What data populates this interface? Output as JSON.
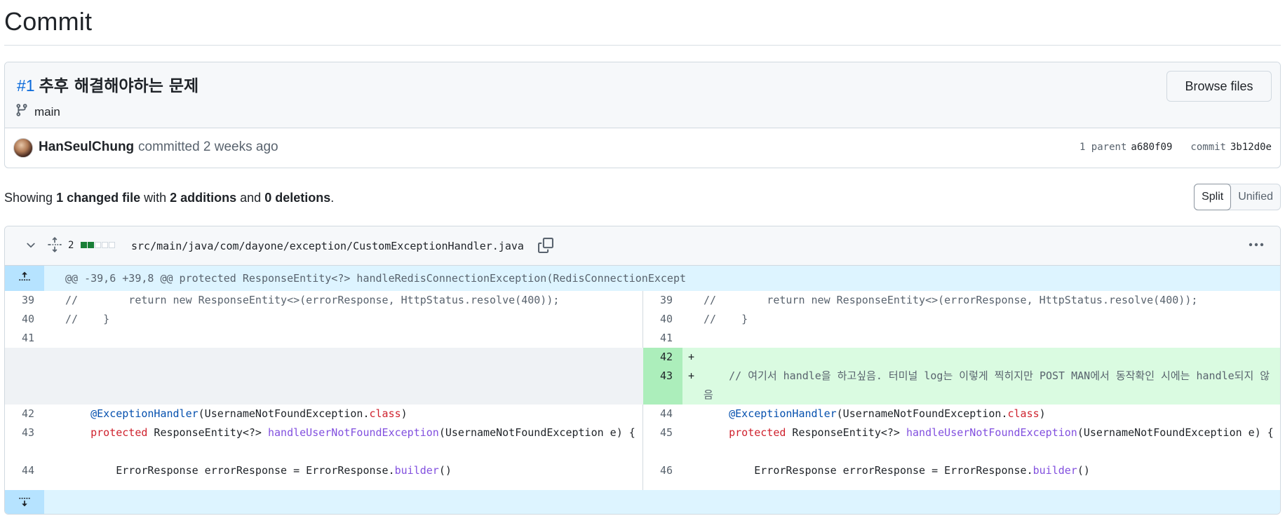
{
  "page": {
    "title": "Commit"
  },
  "commit": {
    "number": "#1",
    "message": "추후 해결해야하는 문제",
    "branch": "main",
    "browse_files_label": "Browse files",
    "author": "HanSeulChung",
    "committed_text": "committed 2 weeks ago",
    "parent_label": "1 parent",
    "parent_sha": "a680f09",
    "commit_label": "commit",
    "commit_sha": "3b12d0e"
  },
  "summary": {
    "prefix": "Showing ",
    "changed": "1 changed file",
    "with": " with ",
    "additions": "2 additions",
    "and": " and ",
    "deletions": "0 deletions",
    "suffix": "."
  },
  "view_toggle": {
    "split": "Split",
    "unified": "Unified",
    "selected": "Split"
  },
  "file": {
    "change_count": "2",
    "diffstat": [
      "add",
      "add",
      "neutral",
      "neutral",
      "neutral"
    ],
    "path": "src/main/java/com/dayone/exception/CustomExceptionHandler.java",
    "hunk_header": "@@ -39,6 +39,8 @@ protected ResponseEntity<?> handleRedisConnectionException(RedisConnectionExcept"
  },
  "diff": {
    "left": [
      {
        "ln": "39",
        "code": "//        return new ResponseEntity<>(errorResponse, HttpStatus.resolve(400));"
      },
      {
        "ln": "40",
        "code": "//    }"
      },
      {
        "ln": "41",
        "code": ""
      },
      {
        "ln": "42",
        "code": "    @ExceptionHandler(UsernameNotFoundException.class)"
      },
      {
        "ln": "43",
        "code": "    protected ResponseEntity<?> handleUserNotFoundException(UsernameNotFoundException e) {"
      },
      {
        "ln": "44",
        "code": "        ErrorResponse errorResponse = ErrorResponse.builder()"
      }
    ],
    "right": [
      {
        "ln": "39",
        "code": "//        return new ResponseEntity<>(errorResponse, HttpStatus.resolve(400));"
      },
      {
        "ln": "40",
        "code": "//    }"
      },
      {
        "ln": "41",
        "code": ""
      },
      {
        "ln": "42",
        "marker": "+",
        "code": ""
      },
      {
        "ln": "43",
        "marker": "+",
        "code": "    // 여기서 handle을 하고싶음. 터미널 log는 이렇게 찍히지만 POST MAN에서 동작확인 시에는 handle되지 않음"
      },
      {
        "ln": "44",
        "code": "    @ExceptionHandler(UsernameNotFoundException.class)"
      },
      {
        "ln": "45",
        "code": "    protected ResponseEntity<?> handleUserNotFoundException(UsernameNotFoundException e) {"
      },
      {
        "ln": "46",
        "code": "        ErrorResponse errorResponse = ErrorResponse.builder()"
      }
    ]
  },
  "colors": {
    "accent": "#0969da",
    "addition": "#1a7f37",
    "add_bg": "#dafbe1",
    "hunk_bg": "#ddf4ff"
  }
}
